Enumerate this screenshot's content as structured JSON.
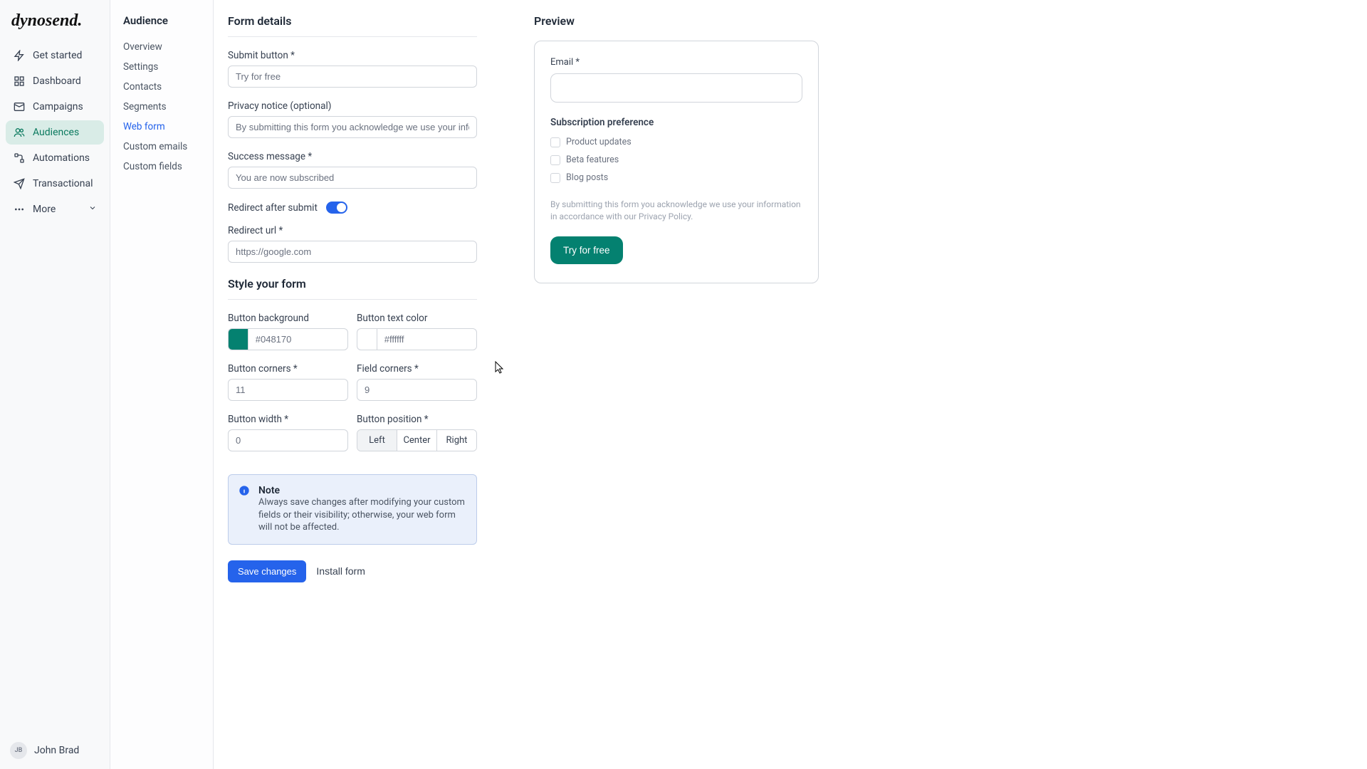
{
  "logo": "dynosend.",
  "mainNav": {
    "getStarted": "Get started",
    "dashboard": "Dashboard",
    "campaigns": "Campaigns",
    "audiences": "Audiences",
    "automations": "Automations",
    "transactional": "Transactional",
    "more": "More"
  },
  "user": {
    "initials": "JB",
    "name": "John Brad"
  },
  "subNav": {
    "title": "Audience",
    "overview": "Overview",
    "settings": "Settings",
    "contacts": "Contacts",
    "segments": "Segments",
    "webForm": "Web form",
    "customEmails": "Custom emails",
    "customFields": "Custom fields"
  },
  "formDetails": {
    "title": "Form details",
    "submitButtonLabel": "Submit button *",
    "submitButtonValue": "Try for free",
    "privacyLabel": "Privacy notice (optional)",
    "privacyValue": "By submitting this form you acknowledge we use your information in accor",
    "successLabel": "Success message *",
    "successValue": "You are now subscribed",
    "redirectAfterLabel": "Redirect after submit",
    "redirectUrlLabel": "Redirect url *",
    "redirectUrlValue": "https://google.com"
  },
  "style": {
    "title": "Style your form",
    "btnBgLabel": "Button background",
    "btnBgValue": "#048170",
    "btnTextLabel": "Button text color",
    "btnTextValue": "#ffffff",
    "btnCornersLabel": "Button corners *",
    "btnCornersValue": "11",
    "fieldCornersLabel": "Field corners *",
    "fieldCornersValue": "9",
    "btnWidthLabel": "Button width *",
    "btnWidthValue": "0",
    "btnPositionLabel": "Button position *",
    "posLeft": "Left",
    "posCenter": "Center",
    "posRight": "Right"
  },
  "note": {
    "title": "Note",
    "text": "Always save changes after modifying your custom fields or their visibility; otherwise, your web form will not be affected."
  },
  "actions": {
    "save": "Save changes",
    "install": "Install form"
  },
  "preview": {
    "title": "Preview",
    "emailLabel": "Email *",
    "subPrefLabel": "Subscription preference",
    "cb1": "Product updates",
    "cb2": "Beta features",
    "cb3": "Blog posts",
    "notice": "By submitting this form you acknowledge we use your information in accordance with our Privacy Policy.",
    "submit": "Try for free"
  }
}
